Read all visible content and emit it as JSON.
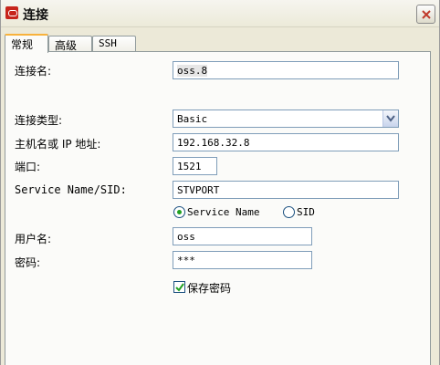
{
  "window": {
    "title": "连接"
  },
  "tabs": [
    {
      "label": "常规",
      "active": true
    },
    {
      "label": "高级",
      "active": false
    },
    {
      "label": "SSH",
      "active": false
    }
  ],
  "form": {
    "connection_name_label": "连接名:",
    "connection_name_value": "oss.8",
    "connection_type_label": "连接类型:",
    "connection_type_value": "Basic",
    "host_label": "主机名或 IP 地址:",
    "host_value": "192.168.32.8",
    "port_label": "端口:",
    "port_value": "1521",
    "service_label": "Service Name/SID:",
    "service_value": "STVPORT",
    "radio_service_name": "Service Name",
    "radio_sid": "SID",
    "radio_selected": "Service Name",
    "username_label": "用户名:",
    "username_value": "oss",
    "password_label": "密码:",
    "password_value": "***",
    "save_password_label": "保存密码",
    "save_password_checked": true
  },
  "icons": {
    "app_icon": "oracle-logo-icon",
    "close_icon": "close-icon",
    "dropdown_icon": "chevron-down-icon",
    "check_icon": "check-icon"
  },
  "colors": {
    "oracle_red": "#c7241b",
    "active_tab_accent": "#f8b23c",
    "field_border": "#7f9db9",
    "radio_dot": "#21a121"
  }
}
